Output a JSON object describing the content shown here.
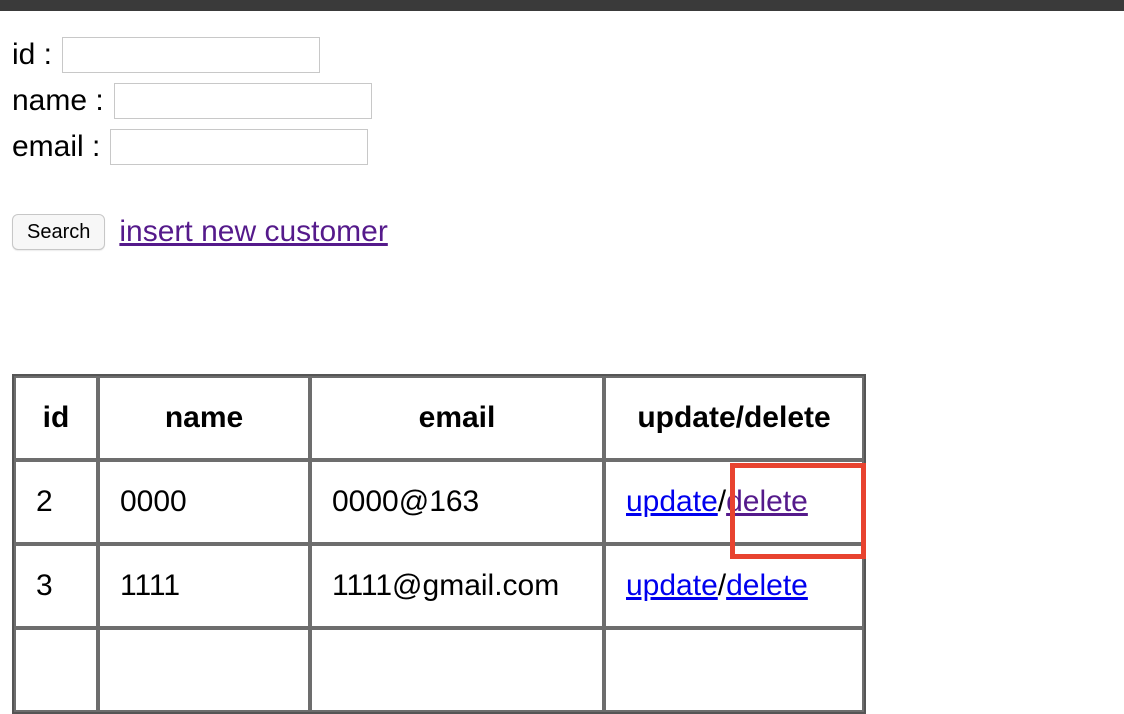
{
  "form": {
    "id_label": "id :",
    "name_label": "name :",
    "email_label": "email :",
    "id_value": "",
    "name_value": "",
    "email_value": ""
  },
  "actions": {
    "search_label": "Search",
    "insert_label": "insert new customer"
  },
  "table": {
    "headers": [
      "id",
      "name",
      "email",
      "update/delete"
    ],
    "rows": [
      {
        "id": "2",
        "name": "0000",
        "email": "0000@163",
        "update": "update",
        "sep": "/",
        "delete": "delete"
      },
      {
        "id": "3",
        "name": "1111",
        "email": "1111@gmail.com",
        "update": "update",
        "sep": "/",
        "delete": "delete"
      },
      {
        "id": "",
        "name": "",
        "email": "",
        "update": "",
        "sep": "",
        "delete": ""
      }
    ]
  },
  "colors": {
    "highlight": "#e8432f",
    "link": "#0000ee",
    "visited_link": "#551a8b"
  }
}
